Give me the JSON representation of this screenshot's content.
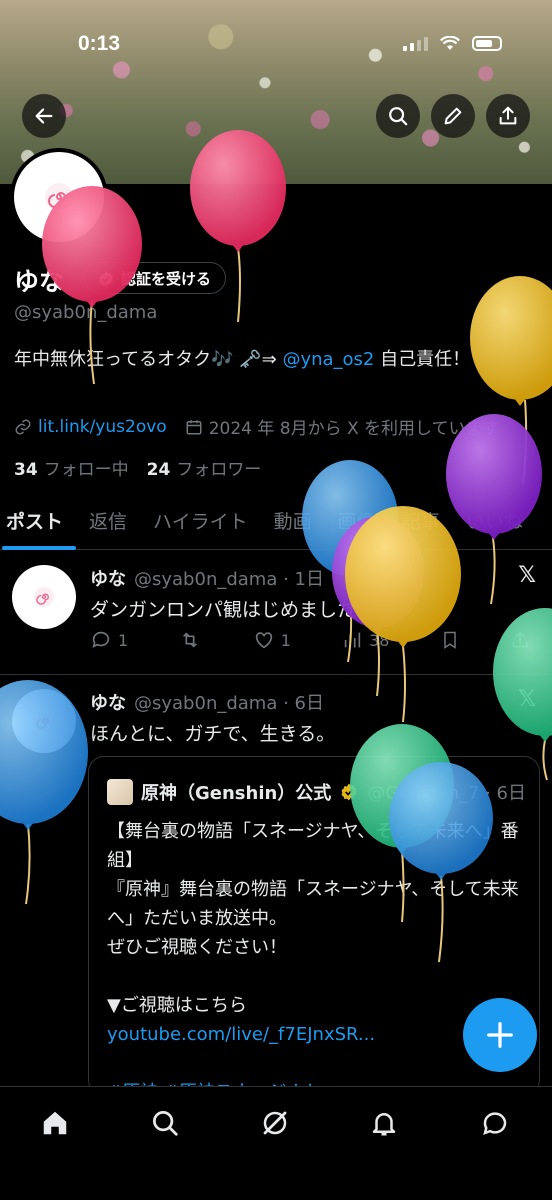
{
  "status": {
    "time": "0:13"
  },
  "profile": {
    "name": "ゆな",
    "verify_label": "認証を受ける",
    "handle": "@syab0n_dama",
    "bio_before": "年中無休狂ってるオタク🎶 🗝️⇒ ",
    "bio_mention": "@yna_os2",
    "bio_after": " 自己責任！",
    "link": "lit.link/yus2ovo",
    "joined": "2024 年 8月から X を利用しています",
    "following_count": "34",
    "following_label": "フォロー中",
    "followers_count": "24",
    "followers_label": "フォロワー"
  },
  "tabs": [
    {
      "label": "ポスト"
    },
    {
      "label": "返信"
    },
    {
      "label": "ハイライト"
    },
    {
      "label": "動画"
    },
    {
      "label": "画像"
    },
    {
      "label": "記事"
    },
    {
      "label": "いいね"
    }
  ],
  "posts": [
    {
      "name": "ゆな",
      "handle_time": "@syab0n_dama · 1日",
      "text": "ダンガンロンパ観はじめました",
      "replies": "1",
      "likes": "1",
      "views": "38"
    },
    {
      "name": "ゆな",
      "handle_time": "@syab0n_dama · 6日",
      "text": "ほんとに、ガチで、生きる。"
    }
  ],
  "quote": {
    "name": "原神（Genshin）公式",
    "handle_time": "@Genshin_7 · 6日",
    "line1": "【舞台裏の物語「スネージナヤ、そして未来へ」番組】",
    "line2": "『原神』舞台裏の物語「スネージナヤ、そして未来へ」ただいま放送中。",
    "line3": "ぜひご視聴ください！",
    "line4": "▼ご視聴はこちら",
    "link": "youtube.com/live/_f7EJnxSR...",
    "hashtags": "#原神 #原神スネージナヤ"
  },
  "colors": {
    "accent": "#1d9bf0",
    "muted": "#71767b",
    "text": "#e7e9ea",
    "background": "#000000"
  },
  "icons": [
    "back-icon",
    "search-icon",
    "pencil-icon",
    "share-icon",
    "home-icon",
    "grok-icon",
    "bell-icon",
    "message-icon",
    "plus-icon"
  ]
}
